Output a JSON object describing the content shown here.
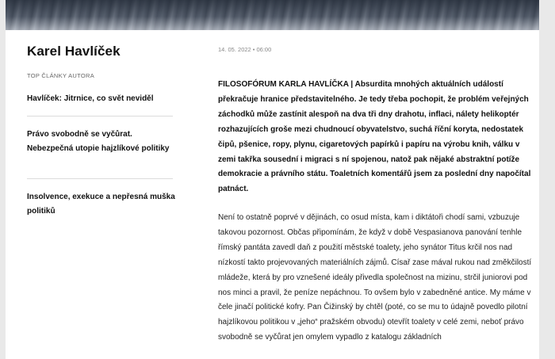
{
  "author": {
    "name": "Karel Havlíček",
    "top_label": "TOP ČLÁNKY AUTORA"
  },
  "sidebar": {
    "articles": [
      {
        "title": "Havlíček: Jitrnice, co svět neviděl"
      },
      {
        "title": "Právo svobodně se vyčůrat. Nebezpečná utopie hajzlíkové politiky"
      },
      {
        "title": "Insolvence, exekuce a nepřesná muška politiků"
      }
    ]
  },
  "article": {
    "date": "14. 05. 2022 • 06:00",
    "lead": "FILOSOFÓRUM KARLA HAVLÍČKA | Absurdita mnohých aktuálních událostí překračuje hranice představitelného. Je tedy třeba pochopit, že problém veřejných záchodků může zastínit alespoň na dva tři dny drahotu, inflaci, nálety helikoptér rozhazujících groše mezi chudnoucí obyvatelstvo, suchá říční koryta, nedostatek čipů, pšenice, ropy, plynu, cigaretových papírků i papíru na výrobu knih, válku v zemi takřka sousední i migraci s ní spojenou, natož pak nějaké abstraktní potíže demokracie a právního státu. Toaletních komentářů jsem za poslední dny napočítal patnáct.",
    "body": "Není to ostatně poprvé v dějinách, co osud místa, kam i diktátoři chodí sami, vzbuzuje takovou pozornost. Občas připomínám, že když v době Vespasianova panování tenhle římský pantáta zavedl daň z použití městské toalety, jeho synátor Titus krčil nos nad nízkostí takto projevovaných materiálních zájmů. Císař zase mával rukou nad změkčilostí mládeže, která by pro vznešené ideály přivedla společnost na mizinu, strčil juniorovi pod nos minci a pravil, že peníze nepáchnou. To ovšem bylo v zabedněné antice. My máme v čele jinačí politické kofry. Pan Čižinský by chtěl (poté, co se mu to údajně povedlo pilotní hajzlíkovou politikou v „jeho“ pražském obvodu) otevřít toalety v celé zemi, neboť právo svobodně se vyčůrat jen omylem vypadlo z katalogu základních"
  }
}
